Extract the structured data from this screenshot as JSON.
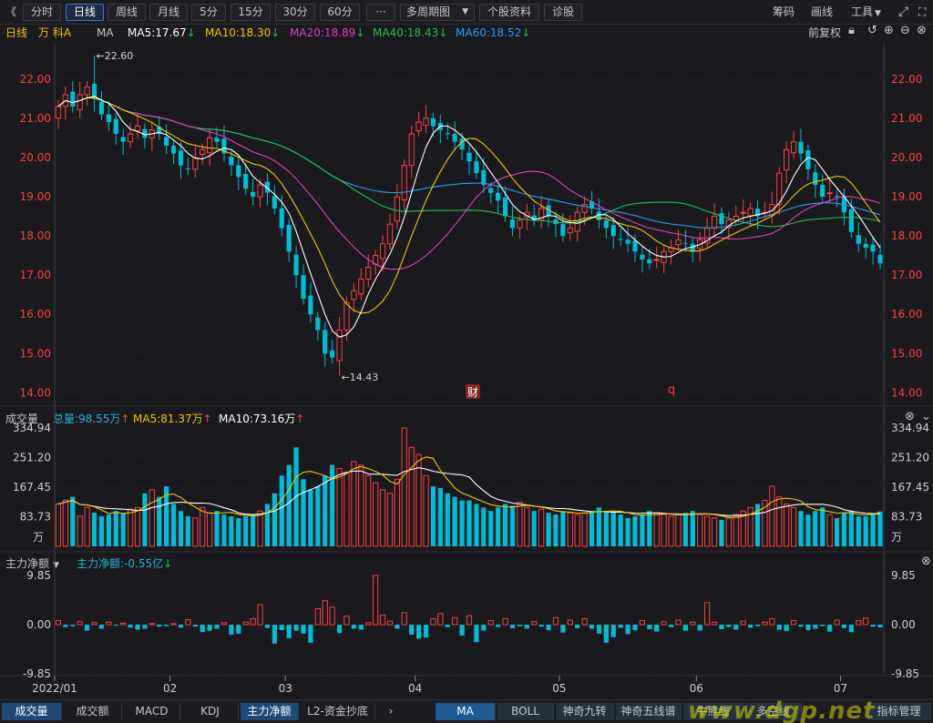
{
  "toolbar": {
    "collapse_icon": "《",
    "periods": [
      "分时",
      "日线",
      "周线",
      "月线",
      "5分",
      "15分",
      "30分",
      "60分"
    ],
    "active_period": "日线",
    "more": "···",
    "multi_period": "多周期图",
    "stock_info": "个股资料",
    "diagnose": "诊股",
    "chips": "筹码",
    "draw": "画线",
    "tools": "工具"
  },
  "main_legend": {
    "period": "日线",
    "name": "万 科A",
    "ma": "MA",
    "ma5": "MA5:17.67",
    "ma10": "MA10:18.30",
    "ma20": "MA20:18.89",
    "ma40": "MA40:18.43",
    "ma60": "MA60:18.52",
    "adjust": "前复权",
    "colors": {
      "ma5": "#ffffff",
      "ma10": "#f0c800",
      "ma20": "#e040c0",
      "ma40": "#22c050",
      "ma60": "#2a9df4",
      "up": "#ff4040",
      "down": "#00bcd4"
    }
  },
  "vol_legend": {
    "title": "成交量",
    "total": "总量:98.55万",
    "ma5": "MA5:81.37万",
    "ma10": "MA10:73.16万"
  },
  "flow_legend": {
    "title": "主力净额",
    "value": "主力净额:-0.55亿"
  },
  "price_axis": [
    "22.00",
    "21.00",
    "20.00",
    "19.00",
    "18.00",
    "17.00",
    "16.00",
    "15.00",
    "14.00"
  ],
  "vol_axis": [
    "334.94",
    "251.20",
    "167.45",
    "83.73",
    "万"
  ],
  "flow_axis": [
    "9.85",
    "0.00",
    "-9.85"
  ],
  "date_axis": [
    "2022/01",
    "02",
    "03",
    "04",
    "05",
    "06",
    "07"
  ],
  "annotations": {
    "high": "22.60",
    "low": "14.43",
    "fin": "财",
    "q": "q"
  },
  "bottom_tabs": [
    "成交量",
    "成交额",
    "MACD",
    "KDJ",
    "主力净额",
    "L2-资金抄底"
  ],
  "active_tabs": [
    "成交量",
    "主力净额"
  ],
  "right_tabs": [
    "MA",
    "BOLL",
    "神奇九转",
    "神奇五线谱",
    "牛熊线",
    "多空线"
  ],
  "active_right_tab": "MA",
  "indicator_manage": "指标管理",
  "watermark": "www.dgp.net",
  "chart_data": {
    "type": "candlestick",
    "note": "",
    "close": [
      21.3,
      21.6,
      21.3,
      21.6,
      21.8,
      21.5,
      21.1,
      20.9,
      20.6,
      20.4,
      20.6,
      20.8,
      20.5,
      20.7,
      20.6,
      20.3,
      20.1,
      19.8,
      19.7,
      20.0,
      20.2,
      20.5,
      20.4,
      20.1,
      19.8,
      19.5,
      19.2,
      19.0,
      19.3,
      19.1,
      18.7,
      18.2,
      17.6,
      17.0,
      16.4,
      16.0,
      15.6,
      15.0,
      14.9,
      15.6,
      16.3,
      16.6,
      16.9,
      17.2,
      17.5,
      17.8,
      18.3,
      19.0,
      19.8,
      20.6,
      20.9,
      21.0,
      20.8,
      20.7,
      20.6,
      20.4,
      20.2,
      19.9,
      19.6,
      19.3,
      19.1,
      18.9,
      18.5,
      18.2,
      18.4,
      18.6,
      18.4,
      18.7,
      18.5,
      18.3,
      18.0,
      18.2,
      18.6,
      18.8,
      18.7,
      18.4,
      18.2,
      18.0,
      17.9,
      17.8,
      17.6,
      17.4,
      17.3,
      17.4,
      17.6,
      17.7,
      17.9,
      17.8,
      17.6,
      17.9,
      18.2,
      18.5,
      18.3,
      18.4,
      18.5,
      18.6,
      18.7,
      18.5,
      18.6,
      18.8,
      19.6,
      20.2,
      20.4,
      20.1,
      19.7,
      19.3,
      19.0,
      19.1,
      19.0,
      18.6,
      18.1,
      17.8,
      17.7,
      17.6,
      17.3
    ],
    "volume": [
      120,
      130,
      140,
      85,
      110,
      95,
      85,
      90,
      100,
      95,
      105,
      110,
      150,
      160,
      140,
      170,
      120,
      100,
      85,
      80,
      110,
      95,
      100,
      90,
      85,
      80,
      85,
      90,
      100,
      120,
      150,
      200,
      230,
      280,
      190,
      160,
      170,
      200,
      230,
      220,
      210,
      240,
      230,
      200,
      180,
      160,
      150,
      190,
      335,
      280,
      260,
      200,
      170,
      165,
      150,
      140,
      130,
      130,
      120,
      110,
      100,
      110,
      120,
      115,
      125,
      110,
      100,
      105,
      95,
      90,
      100,
      95,
      90,
      95,
      100,
      110,
      100,
      95,
      90,
      80,
      85,
      90,
      100,
      95,
      90,
      85,
      90,
      95,
      100,
      90,
      85,
      80,
      75,
      80,
      90,
      100,
      110,
      120,
      130,
      170,
      140,
      120,
      110,
      100,
      90,
      100,
      110,
      90,
      80,
      95,
      100,
      85,
      85,
      90,
      98.55
    ],
    "flow": [
      0.8,
      -0.5,
      -0.3,
      0.6,
      -1.2,
      0.4,
      -0.8,
      0.5,
      -0.2,
      0.3,
      -0.6,
      -1.0,
      -0.8,
      0.2,
      -0.4,
      -0.3,
      0.2,
      -0.6,
      1.0,
      -0.4,
      -1.5,
      -1.2,
      -0.8,
      0.4,
      -2.0,
      -1.8,
      0.5,
      1.2,
      4.0,
      -0.7,
      -3.8,
      -1.1,
      -2.7,
      -1.2,
      -1.8,
      -3.6,
      3.2,
      4.8,
      3.5,
      -1.7,
      1.7,
      -0.8,
      -1.0,
      0.4,
      9.85,
      1.9,
      0.7,
      -0.8,
      2.4,
      -2.0,
      -2.8,
      -2.6,
      1.2,
      2.2,
      -0.5,
      1.4,
      -2.2,
      1.8,
      -3.5,
      -1.2,
      0.8,
      -0.5,
      1.2,
      -0.7,
      -0.3,
      -0.8,
      0.6,
      -0.4,
      -1.1,
      1.4,
      -1.6,
      0.9,
      -0.7,
      1.2,
      -0.8,
      -1.8,
      -3.6,
      -2.5,
      -0.6,
      -1.9,
      -1.1,
      0.8,
      -0.9,
      -1.4,
      0.6,
      -0.5,
      0.9,
      -1.2,
      0.5,
      -1.2,
      4.4,
      0.5,
      -0.9,
      -0.5,
      -1.0,
      0.7,
      -0.6,
      -0.3,
      0.5,
      1.2,
      -1.0,
      -1.3,
      0.8,
      -0.4,
      -1.1,
      -0.8,
      -0.3,
      -1.4,
      0.9,
      -0.7,
      -1.5,
      0.8,
      1.3,
      -0.4,
      -0.55
    ],
    "ylim_price": [
      13.8,
      22.9
    ],
    "ylim_volume": [
      0,
      334.94
    ],
    "ylim_flow": [
      -9.85,
      9.85
    ]
  }
}
